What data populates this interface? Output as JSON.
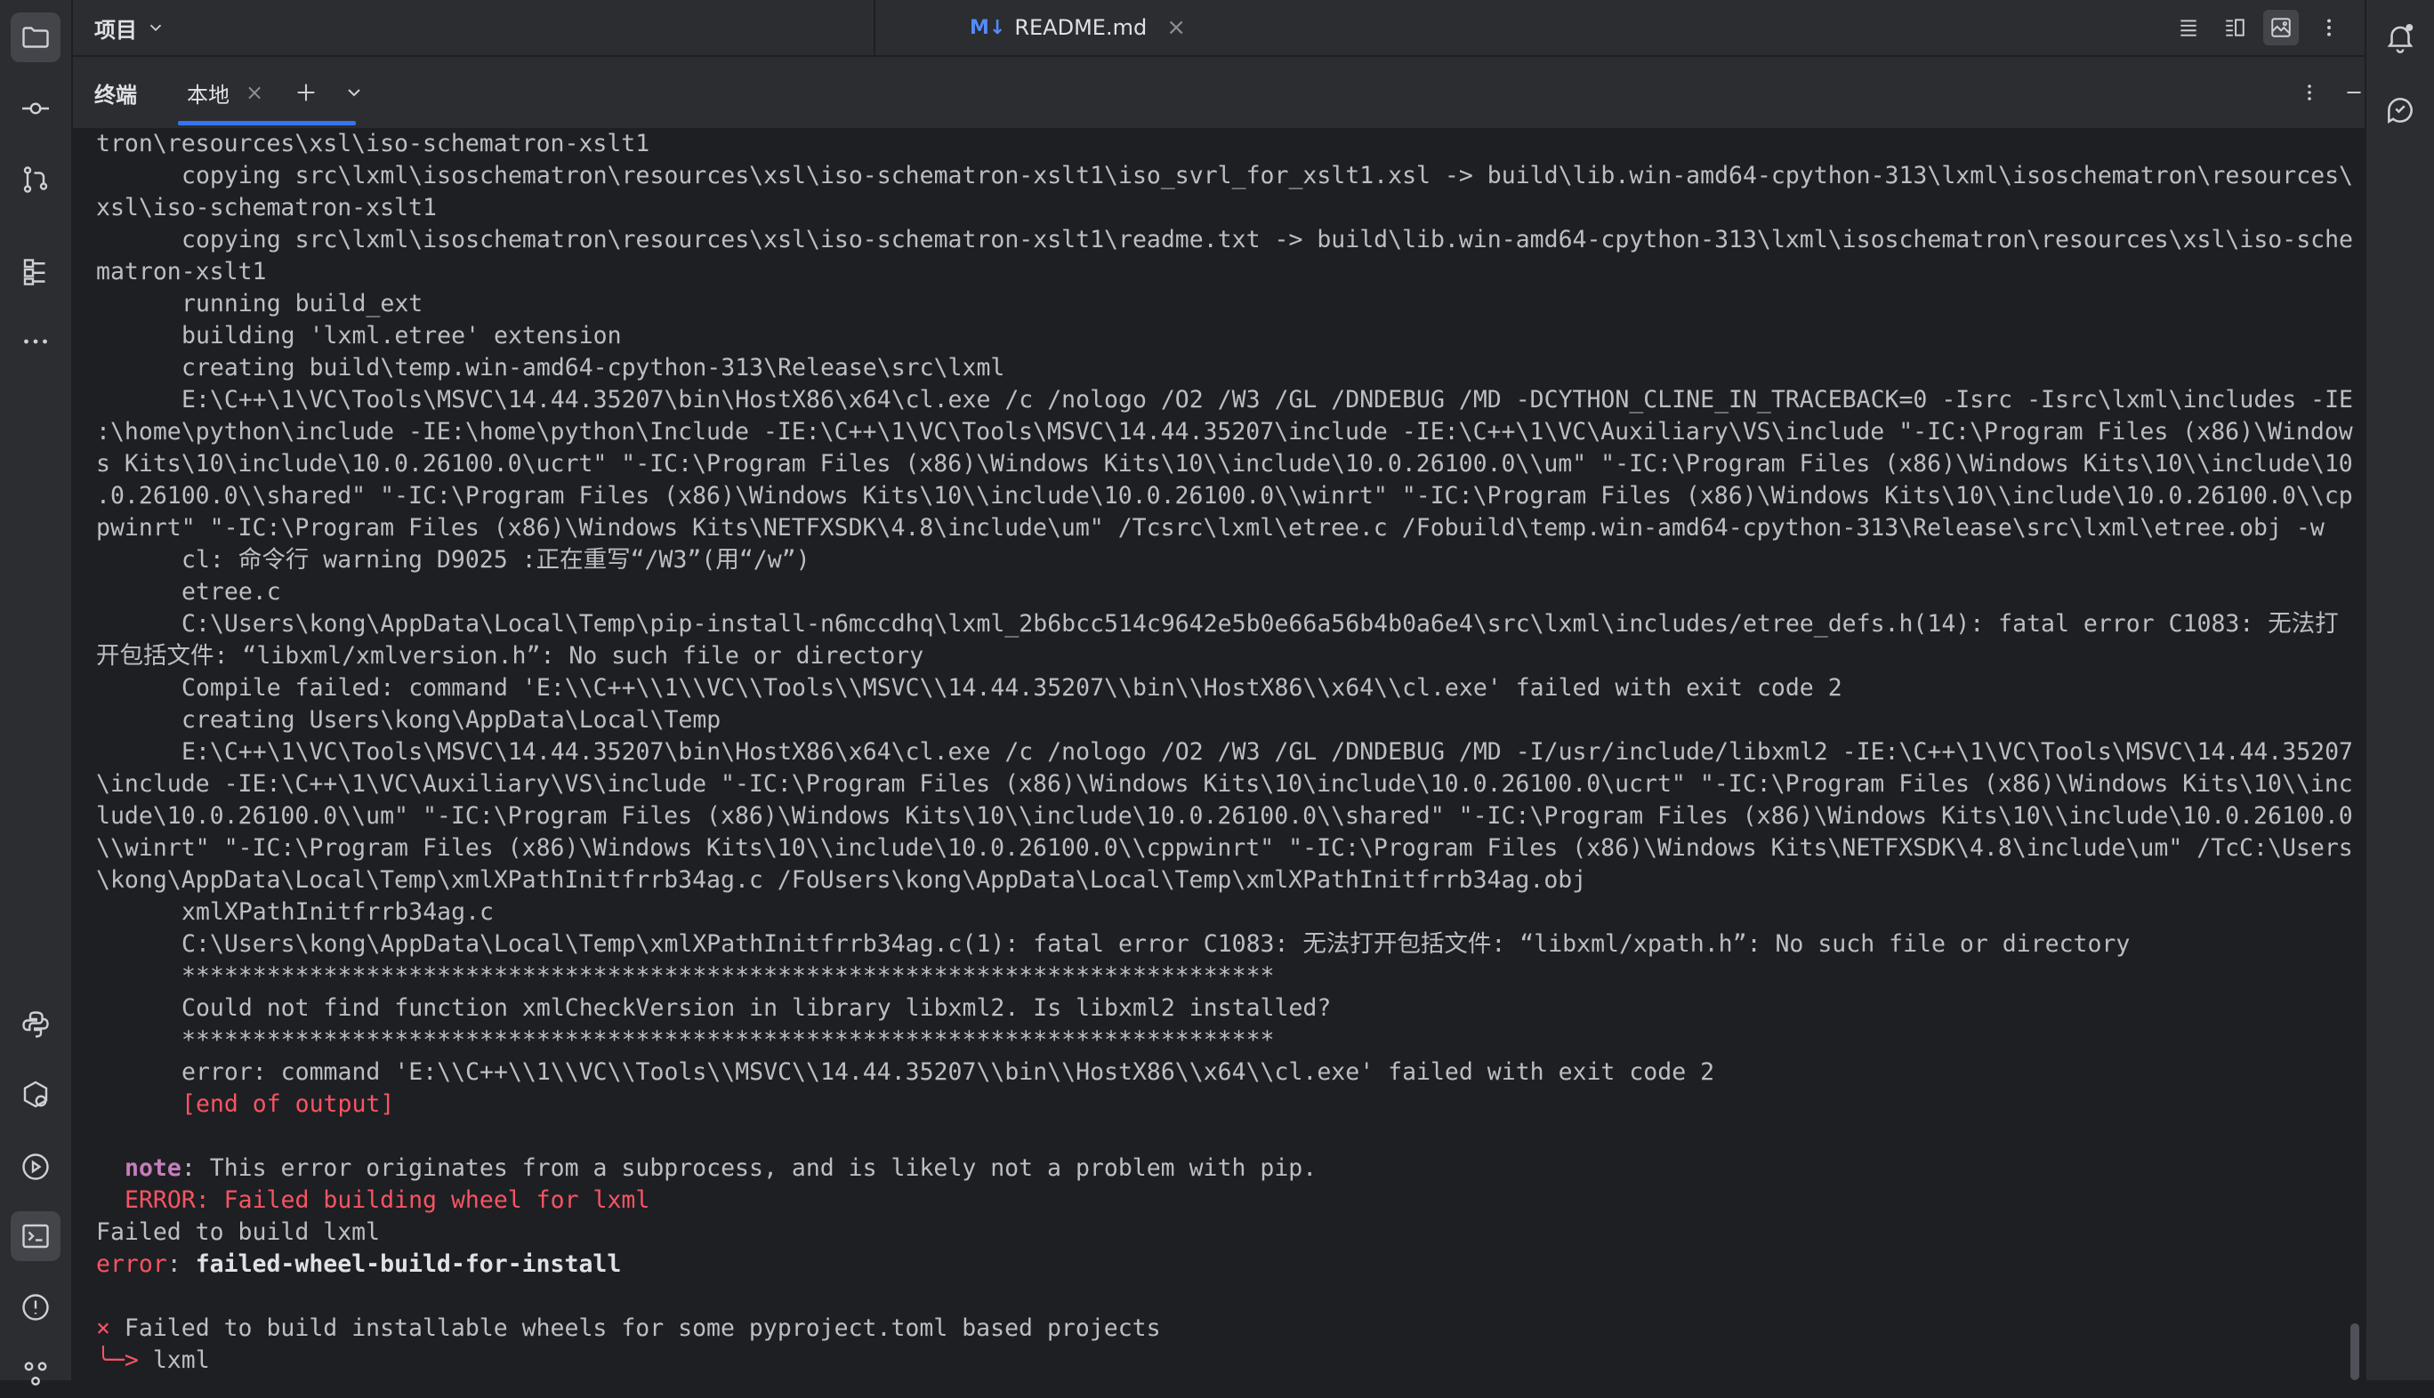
{
  "project": {
    "label": "项目"
  },
  "editor_tab": {
    "badge": "M↓",
    "label": "README.md",
    "close": "×"
  },
  "terminal_bar": {
    "title": "终端",
    "tab_label": "本地",
    "tab_close": "×",
    "add": "+"
  },
  "left_icons": [
    "folder-icon",
    "commit-icon",
    "branch-icon",
    "structure-icon",
    "more-icon",
    "python-packages-icon",
    "services-icon",
    "run-icon",
    "terminal-icon",
    "problems-icon",
    "vcs-icon"
  ],
  "right_icons": [
    "notifications-icon",
    "ai-assistant-icon"
  ],
  "terminal": {
    "lines": [
      {
        "t": "tron\\resources\\xsl\\iso-schematron-xslt1",
        "c": ""
      },
      {
        "t": "copying src\\lxml\\isoschematron\\resources\\xsl\\iso-schematron-xslt1\\iso_svrl_for_xslt1.xsl -> build\\lib.win-amd64-cpython-313\\lxml\\isoschematron\\resources\\",
        "c": "ind"
      },
      {
        "t": "xsl\\iso-schematron-xslt1",
        "c": ""
      },
      {
        "t": "copying src\\lxml\\isoschematron\\resources\\xsl\\iso-schematron-xslt1\\readme.txt -> build\\lib.win-amd64-cpython-313\\lxml\\isoschematron\\resources\\xsl\\iso-sche",
        "c": "ind"
      },
      {
        "t": "matron-xslt1",
        "c": ""
      },
      {
        "t": "running build_ext",
        "c": "ind"
      },
      {
        "t": "building 'lxml.etree' extension",
        "c": "ind"
      },
      {
        "t": "creating build\\temp.win-amd64-cpython-313\\Release\\src\\lxml",
        "c": "ind"
      },
      {
        "t": "E:\\C++\\1\\VC\\Tools\\MSVC\\14.44.35207\\bin\\HostX86\\x64\\cl.exe /c /nologo /O2 /W3 /GL /DNDEBUG /MD -DCYTHON_CLINE_IN_TRACEBACK=0 -Isrc -Isrc\\lxml\\includes -IE",
        "c": "ind"
      },
      {
        "t": ":\\home\\python\\include -IE:\\home\\python\\Include -IE:\\C++\\1\\VC\\Tools\\MSVC\\14.44.35207\\include -IE:\\C++\\1\\VC\\Auxiliary\\VS\\include \"-IC:\\Program Files (x86)\\Window",
        "c": ""
      },
      {
        "t": "s Kits\\10\\include\\10.0.26100.0\\ucrt\" \"-IC:\\Program Files (x86)\\Windows Kits\\10\\\\include\\10.0.26100.0\\\\um\" \"-IC:\\Program Files (x86)\\Windows Kits\\10\\\\include\\10",
        "c": ""
      },
      {
        "t": ".0.26100.0\\\\shared\" \"-IC:\\Program Files (x86)\\Windows Kits\\10\\\\include\\10.0.26100.0\\\\winrt\" \"-IC:\\Program Files (x86)\\Windows Kits\\10\\\\include\\10.0.26100.0\\\\cp",
        "c": ""
      },
      {
        "t": "pwinrt\" \"-IC:\\Program Files (x86)\\Windows Kits\\NETFXSDK\\4.8\\include\\um\" /Tcsrc\\lxml\\etree.c /Fobuild\\temp.win-amd64-cpython-313\\Release\\src\\lxml\\etree.obj -w",
        "c": ""
      },
      {
        "t": "cl: 命令行 warning D9025 :正在重写“/W3”(用“/w”)",
        "c": "ind"
      },
      {
        "t": "etree.c",
        "c": "ind"
      },
      {
        "t": "C:\\Users\\kong\\AppData\\Local\\Temp\\pip-install-n6mccdhq\\lxml_2b6bcc514c9642e5b0e66a56b4b0a6e4\\src\\lxml\\includes/etree_defs.h(14): fatal error C1083: 无法打",
        "c": "ind"
      },
      {
        "t": "开包括文件: “libxml/xmlversion.h”: No such file or directory",
        "c": ""
      },
      {
        "t": "Compile failed: command 'E:\\\\C++\\\\1\\\\VC\\\\Tools\\\\MSVC\\\\14.44.35207\\\\bin\\\\HostX86\\\\x64\\\\cl.exe' failed with exit code 2",
        "c": "ind"
      },
      {
        "t": "creating Users\\kong\\AppData\\Local\\Temp",
        "c": "ind"
      },
      {
        "t": "E:\\C++\\1\\VC\\Tools\\MSVC\\14.44.35207\\bin\\HostX86\\x64\\cl.exe /c /nologo /O2 /W3 /GL /DNDEBUG /MD -I/usr/include/libxml2 -IE:\\C++\\1\\VC\\Tools\\MSVC\\14.44.35207",
        "c": "ind"
      },
      {
        "t": "\\include -IE:\\C++\\1\\VC\\Auxiliary\\VS\\include \"-IC:\\Program Files (x86)\\Windows Kits\\10\\include\\10.0.26100.0\\ucrt\" \"-IC:\\Program Files (x86)\\Windows Kits\\10\\\\inc",
        "c": ""
      },
      {
        "t": "lude\\10.0.26100.0\\\\um\" \"-IC:\\Program Files (x86)\\Windows Kits\\10\\\\include\\10.0.26100.0\\\\shared\" \"-IC:\\Program Files (x86)\\Windows Kits\\10\\\\include\\10.0.26100.0",
        "c": ""
      },
      {
        "t": "\\\\winrt\" \"-IC:\\Program Files (x86)\\Windows Kits\\10\\\\include\\10.0.26100.0\\\\cppwinrt\" \"-IC:\\Program Files (x86)\\Windows Kits\\NETFXSDK\\4.8\\include\\um\" /TcC:\\Users",
        "c": ""
      },
      {
        "t": "\\kong\\AppData\\Local\\Temp\\xmlXPathInitfrrb34ag.c /FoUsers\\kong\\AppData\\Local\\Temp\\xmlXPathInitfrrb34ag.obj",
        "c": ""
      },
      {
        "t": "xmlXPathInitfrrb34ag.c",
        "c": "ind"
      },
      {
        "t": "C:\\Users\\kong\\AppData\\Local\\Temp\\xmlXPathInitfrrb34ag.c(1): fatal error C1083: 无法打开包括文件: “libxml/xpath.h”: No such file or directory",
        "c": "ind"
      },
      {
        "t": "*****************************************************************************",
        "c": "ind"
      },
      {
        "t": "Could not find function xmlCheckVersion in library libxml2. Is libxml2 installed?",
        "c": "ind"
      },
      {
        "t": "*****************************************************************************",
        "c": "ind"
      },
      {
        "t": "error: command 'E:\\\\C++\\\\1\\\\VC\\\\Tools\\\\MSVC\\\\14.44.35207\\\\bin\\\\HostX86\\\\x64\\\\cl.exe' failed with exit code 2",
        "c": "ind"
      },
      {
        "t": "[end of output]",
        "c": "ind red"
      },
      {
        "t": "",
        "c": ""
      }
    ],
    "note_label": "note",
    "note_text": ": This error originates from a subprocess, and is likely not a problem with pip.",
    "error_wheel": "ERROR: Failed building wheel for lxml",
    "failed_build": "Failed to build lxml",
    "error_label": "error",
    "error_colon": ": ",
    "error_value": "failed-wheel-build-for-install",
    "x_mark": "×",
    "failed_wheels": " Failed to build installable wheels for some pyproject.toml based projects",
    "arrow": "╰─>",
    "arrow_pkg": " lxml"
  }
}
